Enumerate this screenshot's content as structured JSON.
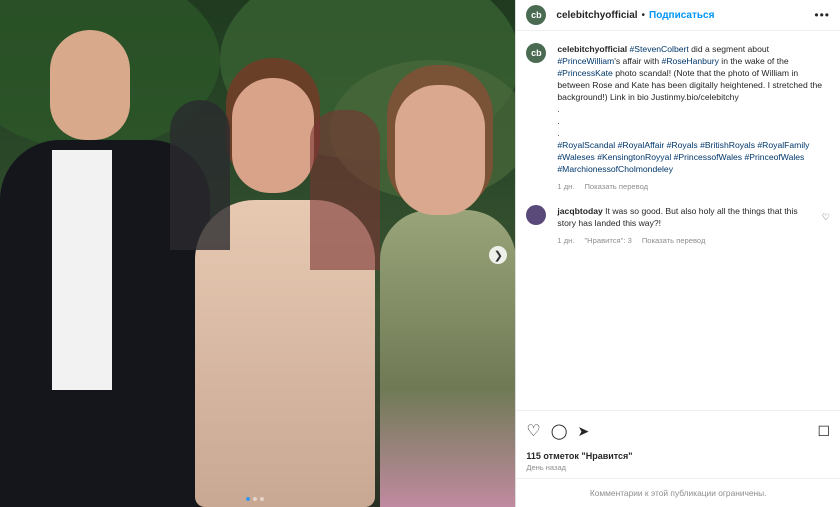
{
  "post": {
    "username": "celebitchyofficial",
    "follow_label": "Подписаться",
    "avatar_text": "cb"
  },
  "caption": {
    "username": "celebitchyofficial",
    "segments": [
      {
        "t": "#StevenColbert",
        "link": true
      },
      {
        "t": " did a segment about ",
        "link": false
      },
      {
        "t": "#PrinceWilliam",
        "link": true
      },
      {
        "t": "'s affair with ",
        "link": false
      },
      {
        "t": "#RoseHanbury",
        "link": true
      },
      {
        "t": " in the wake of the ",
        "link": false
      },
      {
        "t": "#PrincessKate",
        "link": true
      },
      {
        "t": " photo scandal! (Note that the photo of William in between Rose and Kate has been digitally heightened. I stretched the background!) Link in bio Justinmy.bio/celebitchy",
        "link": false
      }
    ],
    "dots": [
      ".",
      ".",
      "."
    ],
    "hashtags": [
      "#RoyalScandal",
      "#RoyalAffair",
      "#Royals",
      "#BritishRoyals",
      "#RoyalFamily",
      "#Waleses",
      "#KensingtonRoyyal",
      "#PrincessofWales",
      "#PrinceofWales",
      "#MarchionessofCholmondeley"
    ],
    "age": "1 дн.",
    "translate": "Показать перевод"
  },
  "reply": {
    "username": "jacqbtoday",
    "text": "It was so good. But also holy all the things that this story has landed this way?!",
    "age": "1 дн.",
    "likes": "\"Нравится\": 3",
    "translate": "Показать перевод"
  },
  "icons": {
    "like": "heart-icon",
    "comment": "comment-icon",
    "share": "send-icon",
    "save": "bookmark-icon",
    "more": "more-icon",
    "next": "chevron-right-icon"
  },
  "stats": {
    "likes": "115 отметок \"Нравится\"",
    "time": "День назад"
  },
  "footer": {
    "limited": "Комментарии к этой публикации ограничены."
  },
  "carousel": {
    "count": 3,
    "active": 1
  },
  "colors": {
    "link": "#00376b",
    "follow": "#0095f6",
    "muted": "#8e8e8e"
  }
}
